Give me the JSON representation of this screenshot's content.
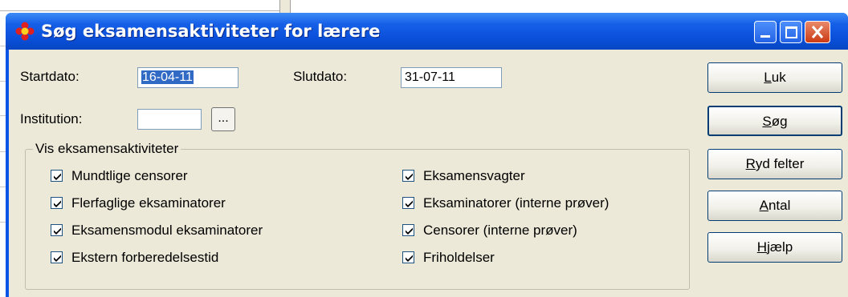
{
  "window": {
    "title": "Søg eksamensaktiviteter for lærere"
  },
  "form": {
    "startdato_label": "Startdato:",
    "startdato_value": "16-04-11",
    "slutdato_label": "Slutdato:",
    "slutdato_value": "31-07-11",
    "institution_label": "Institution:",
    "institution_value": "",
    "browse_label": "..."
  },
  "group": {
    "title": "Vis eksamensaktiviteter",
    "left_items": [
      {
        "label": "Mundtlige censorer",
        "checked": true
      },
      {
        "label": "Flerfaglige eksaminatorer",
        "checked": true
      },
      {
        "label": "Eksamensmodul eksaminatorer",
        "checked": true
      },
      {
        "label": "Ekstern forberedelsestid",
        "checked": true
      }
    ],
    "right_items": [
      {
        "label": "Eksamensvagter",
        "checked": true
      },
      {
        "label": "Eksaminatorer (interne prøver)",
        "checked": true
      },
      {
        "label": "Censorer (interne prøver)",
        "checked": true
      },
      {
        "label": "Friholdelser",
        "checked": true
      }
    ]
  },
  "buttons": {
    "luk": {
      "accel": "L",
      "rest": "uk"
    },
    "sog": {
      "accel": "S",
      "rest": "øg"
    },
    "ryd": {
      "accel": "R",
      "rest": "yd felter"
    },
    "antal": {
      "accel": "A",
      "rest": "ntal"
    },
    "hjaelp": {
      "accel": "H",
      "rest": "jælp"
    }
  },
  "colors": {
    "titlebar": "#0a4fd9",
    "client": "#ece9d8",
    "selection": "#316ac5",
    "close_button": "#cc3a14"
  }
}
